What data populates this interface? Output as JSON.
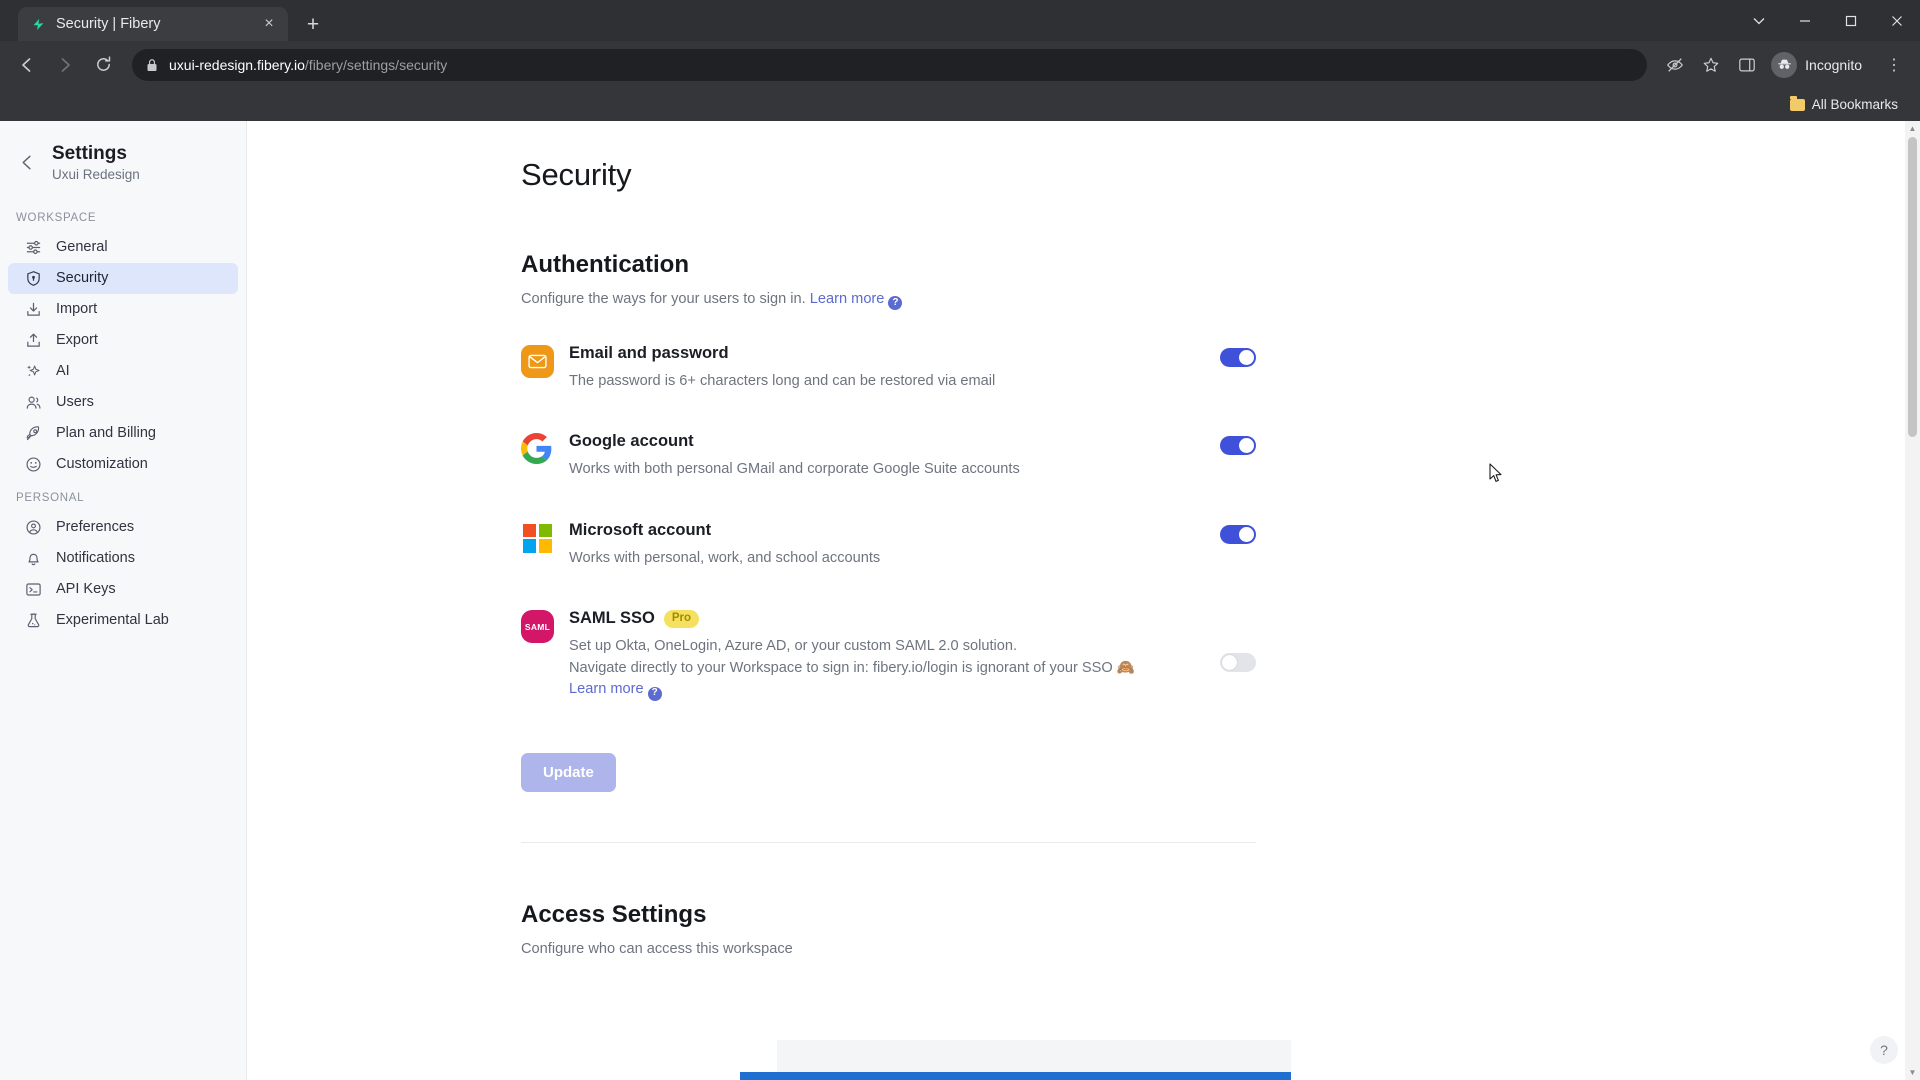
{
  "browser": {
    "tab": {
      "title": "Security | Fibery",
      "favicon": "fibery-logo-icon",
      "close": "×"
    },
    "new_tab_label": "+",
    "window_controls": {
      "minimize": "−",
      "maximize": "▢",
      "close": "✕",
      "more": "⌄"
    },
    "nav": {
      "back": "←",
      "forward": "→",
      "reload": "⟳"
    },
    "omnibox": {
      "lock": "lock-icon",
      "host": "uxui-redesign.fibery.io",
      "path": "/fibery/settings/security"
    },
    "toolbar_icons": [
      "eye-off-icon",
      "star-icon",
      "side-panel-icon"
    ],
    "profile": {
      "label": "Incognito",
      "icon": "incognito-icon"
    },
    "menu": "⋮",
    "bookmarks": {
      "folder_label": "All Bookmarks"
    }
  },
  "sidebar": {
    "back": "←",
    "title": "Settings",
    "subtitle": "Uxui Redesign",
    "groups": [
      {
        "label": "WORKSPACE",
        "items": [
          {
            "label": "General",
            "icon": "sliders-icon",
            "active": false
          },
          {
            "label": "Security",
            "icon": "shield-icon",
            "active": true
          },
          {
            "label": "Import",
            "icon": "download-icon",
            "active": false
          },
          {
            "label": "Export",
            "icon": "upload-icon",
            "active": false
          },
          {
            "label": "AI",
            "icon": "sparkle-icon",
            "active": false
          },
          {
            "label": "Users",
            "icon": "users-icon",
            "active": false
          },
          {
            "label": "Plan and Billing",
            "icon": "rocket-icon",
            "active": false
          },
          {
            "label": "Customization",
            "icon": "smiley-icon",
            "active": false
          }
        ]
      },
      {
        "label": "PERSONAL",
        "items": [
          {
            "label": "Preferences",
            "icon": "user-circle-icon",
            "active": false
          },
          {
            "label": "Notifications",
            "icon": "bell-icon",
            "active": false
          },
          {
            "label": "API Keys",
            "icon": "terminal-icon",
            "active": false
          },
          {
            "label": "Experimental Lab",
            "icon": "flask-icon",
            "active": false
          }
        ]
      }
    ]
  },
  "main": {
    "page_title": "Security",
    "authentication": {
      "heading": "Authentication",
      "description": "Configure the ways for your users to sign in.",
      "learn_more": "Learn more",
      "help_glyph": "?",
      "methods": [
        {
          "name": "Email and password",
          "description": "The password is 6+ characters long and can be restored via email",
          "icon": "email-icon",
          "enabled": true,
          "badge": null
        },
        {
          "name": "Google account",
          "description": "Works with both personal GMail and corporate Google Suite accounts",
          "icon": "google-icon",
          "enabled": true,
          "badge": null
        },
        {
          "name": "Microsoft account",
          "description": "Works with personal, work, and school accounts",
          "icon": "microsoft-icon",
          "enabled": true,
          "badge": null
        },
        {
          "name": "SAML SSO",
          "icon": "saml-icon",
          "icon_text": "SAML",
          "badge": "Pro",
          "enabled": false,
          "description_line1": "Set up Okta, OneLogin, Azure AD, or your custom SAML 2.0 solution.",
          "description_line2": "Navigate directly to your Workspace to sign in: fibery.io/login is ignorant of your SSO 🙈",
          "learn_more": "Learn more"
        }
      ],
      "update_button": "Update"
    },
    "access_settings": {
      "heading": "Access Settings",
      "description": "Configure who can access this workspace"
    }
  },
  "overlays": {
    "help_fab": "?",
    "scrollbar": {
      "up": "▲",
      "down": "▼"
    }
  },
  "colors": {
    "accent_blue": "#3f51d9",
    "link": "#5b6bd0",
    "sidebar_active": "#dde6fb",
    "email_icon": "#ef9817",
    "saml_icon": "#d31667",
    "pro_badge": "#f5e15f",
    "update_button": "#aeb5ea",
    "ms_red": "#f25022",
    "ms_green": "#7fba00",
    "ms_blue": "#00a4ef",
    "ms_yellow": "#ffb900"
  }
}
